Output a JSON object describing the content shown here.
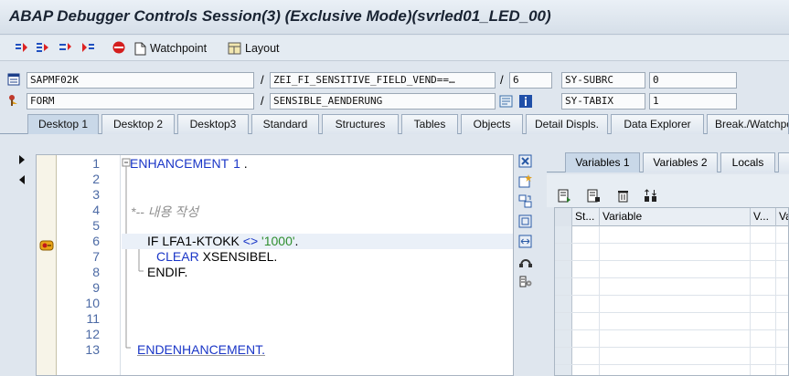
{
  "window": {
    "title": "ABAP Debugger Controls Session(3)  (Exclusive Mode)(svrled01_LED_00)"
  },
  "toolbar": {
    "watchpoint_label": "Watchpoint",
    "layout_label": "Layout"
  },
  "info": {
    "program": "SAPMF02K",
    "include": "ZEI_FI_SENSITIVE_FIELD_VEND==…",
    "line": "6",
    "sysvar1_name": "SY-SUBRC",
    "sysvar1_value": "0",
    "event_type": "FORM",
    "event_name": "SENSIBLE_AENDERUNG",
    "sysvar2_name": "SY-TABIX",
    "sysvar2_value": "1"
  },
  "tabs": [
    "Desktop 1",
    "Desktop 2",
    "Desktop3",
    "Standard",
    "Structures",
    "Tables",
    "Objects",
    "Detail Displs.",
    "Data Explorer",
    "Break./Watchpoi"
  ],
  "code": {
    "line_numbers": [
      "1",
      "2",
      "3",
      "4",
      "5",
      "6",
      "7",
      "8",
      "9",
      "10",
      "11",
      "12",
      "13"
    ],
    "l1_kw": "ENHANCEMENT",
    "l1_num": "1",
    "l1_rest": " .",
    "l4_comment": "*-- 내용 작성",
    "l6_if": "IF",
    "l6_field": " LFA1-KTOKK ",
    "l6_op": "<>",
    "l6_str": " '1000'",
    "l6_end": ".",
    "l7_kw": "CLEAR",
    "l7_rest": " XSENSIBEL.",
    "l8_kw": "ENDIF.",
    "l13_kw": "ENDENHANCEMENT."
  },
  "variables": {
    "tabs": [
      "Variables 1",
      "Variables 2",
      "Locals"
    ],
    "columns": [
      "St...",
      "Variable",
      "V...",
      "Va"
    ]
  }
}
